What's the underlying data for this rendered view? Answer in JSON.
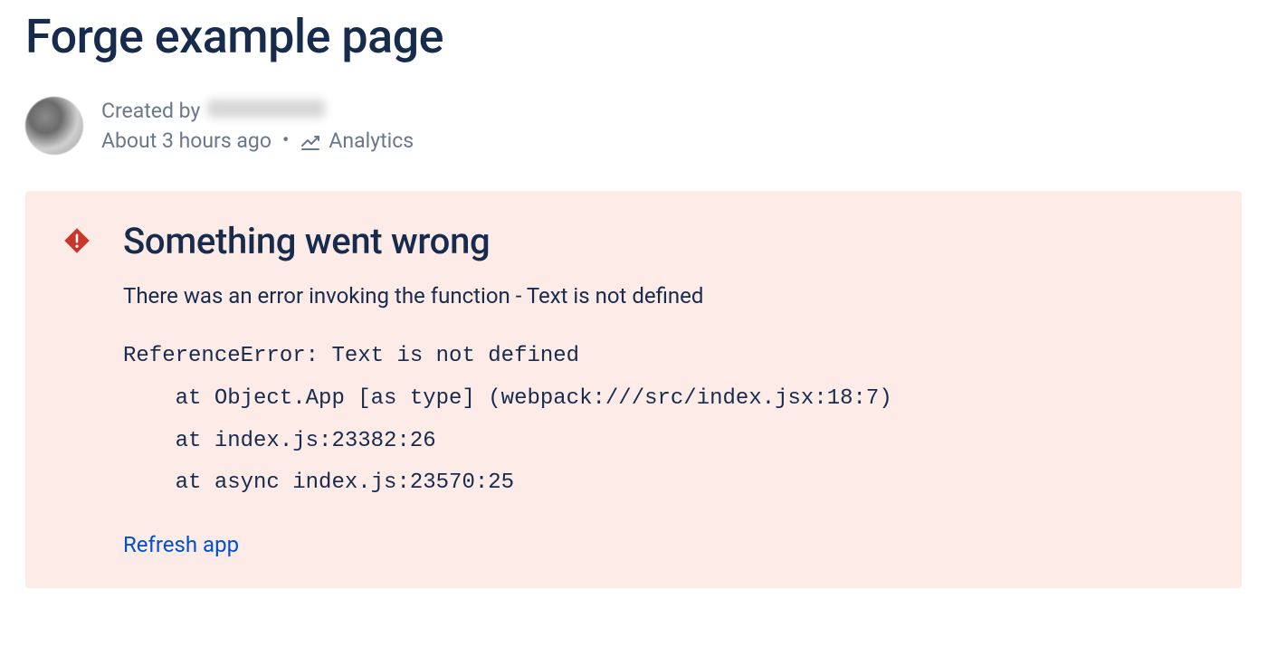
{
  "page": {
    "title": "Forge example page"
  },
  "byline": {
    "created_by_label": "Created by",
    "timestamp": "About 3 hours ago",
    "analytics_label": "Analytics"
  },
  "error": {
    "title": "Something went wrong",
    "message": "There was an error invoking the function - Text is not defined",
    "stack": "ReferenceError: Text is not defined\n    at Object.App [as type] (webpack:///src/index.jsx:18:7)\n    at index.js:23382:26\n    at async index.js:23570:25",
    "refresh_label": "Refresh app"
  }
}
